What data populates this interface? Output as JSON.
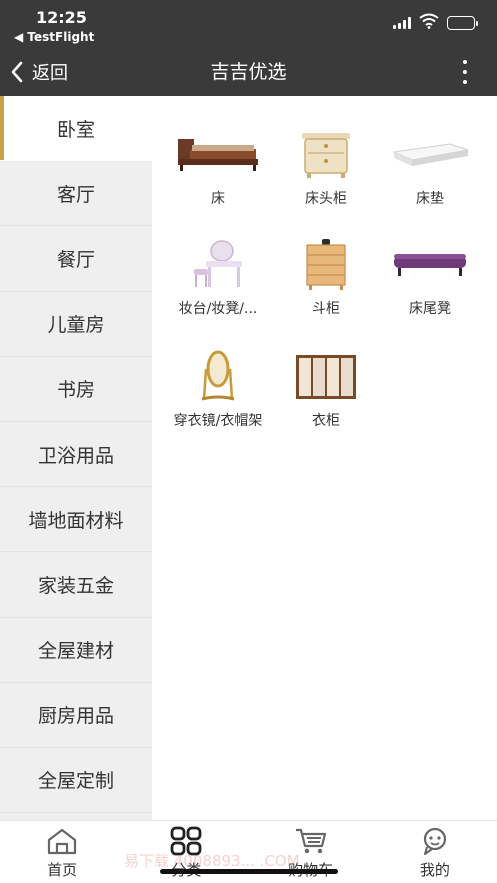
{
  "status": {
    "time": "12:25",
    "back_app": "◀ TestFlight"
  },
  "nav": {
    "back_label": "返回",
    "title": "吉吉优选"
  },
  "sidebar": {
    "items": [
      {
        "label": "卧室",
        "active": true
      },
      {
        "label": "客厅"
      },
      {
        "label": "餐厅"
      },
      {
        "label": "儿童房"
      },
      {
        "label": "书房"
      },
      {
        "label": "卫浴用品"
      },
      {
        "label": "墙地面材料"
      },
      {
        "label": "家装五金"
      },
      {
        "label": "全屋建材"
      },
      {
        "label": "厨房用品"
      },
      {
        "label": "全屋定制"
      }
    ]
  },
  "products": [
    {
      "label": "床",
      "icon": "bed-icon"
    },
    {
      "label": "床头柜",
      "icon": "nightstand-icon"
    },
    {
      "label": "床垫",
      "icon": "mattress-icon"
    },
    {
      "label": "妆台/妆凳/...",
      "icon": "vanity-icon"
    },
    {
      "label": "斗柜",
      "icon": "chest-of-drawers-icon"
    },
    {
      "label": "床尾凳",
      "icon": "bench-icon"
    },
    {
      "label": "穿衣镜/衣帽架",
      "icon": "mirror-icon"
    },
    {
      "label": "衣柜",
      "icon": "wardrobe-icon"
    }
  ],
  "tabbar": {
    "items": [
      {
        "label": "首页",
        "icon": "home-icon"
      },
      {
        "label": "分类",
        "icon": "category-icon",
        "active": true
      },
      {
        "label": "购物车",
        "icon": "cart-icon"
      },
      {
        "label": "我的",
        "icon": "profile-icon"
      }
    ]
  },
  "watermark": "易下载 4008893... .COM",
  "colors": {
    "nav_bg": "#3a3a3a",
    "accent": "#c9a14a",
    "sidebar_bg": "#efefef"
  }
}
